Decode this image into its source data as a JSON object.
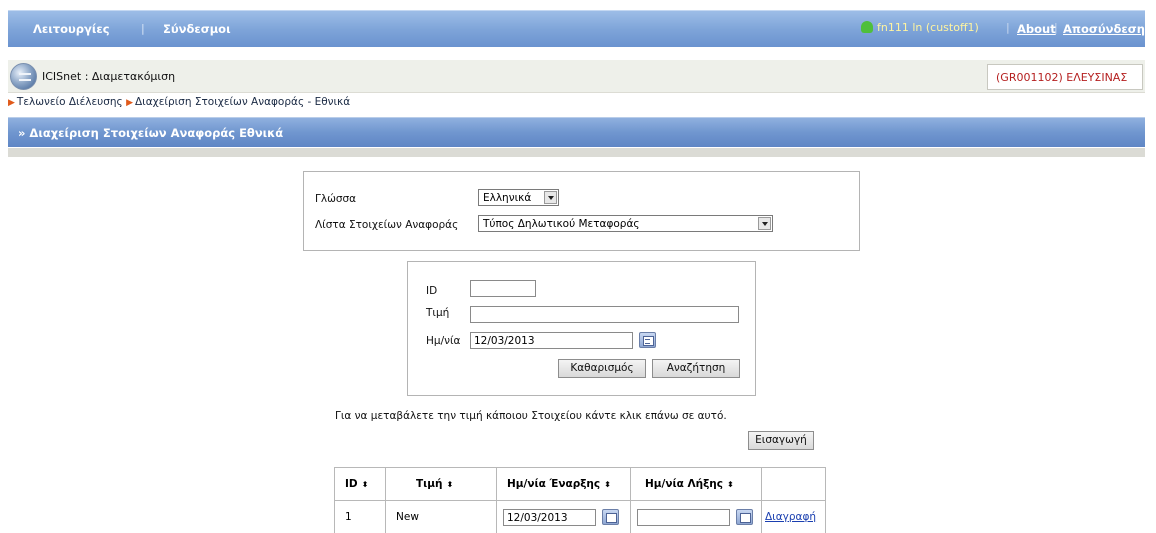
{
  "topbar": {
    "menu_label": "Λειτουργίες",
    "links_label": "Σύνδεσμοι",
    "user_label": "fn111 ln (custoff1)",
    "about_label": "About",
    "logout_label": "Αποσύνδεση",
    "accent": "#7fa5d9"
  },
  "app": {
    "title": "ICISnet : Διαμετακόμιση",
    "office": "(GR001102) ΕΛΕΥΣΙΝΑΣ"
  },
  "breadcrumb": {
    "items": [
      "Τελωνείο Διέλευσης",
      "Διαχείριση Στοιχείων Αναφοράς - Εθνικά"
    ]
  },
  "section": {
    "title": "» Διαχείριση Στοιχείων Αναφοράς Εθνικά"
  },
  "filters": {
    "language_label": "Γλώσσα",
    "language_value": "Ελληνικά",
    "list_label": "Λίστα Στοιχείων Αναφοράς",
    "list_value": "Τύπος Δηλωτικού Μεταφοράς"
  },
  "search": {
    "id_label": "ID",
    "id_value": "",
    "value_label": "Τιμή",
    "value_value": "",
    "date_label": "Ημ/νία",
    "date_value": "12/03/2013",
    "clear_label": "Καθαρισμός",
    "search_label": "Αναζήτηση"
  },
  "hint": "Για να μεταβάλετε την τιμή κάποιου Στοιχείου κάντε κλικ επάνω σε αυτό.",
  "insert_label": "Εισαγωγή",
  "table": {
    "headers": [
      "ID",
      "Τιμή",
      "Ημ/νία Έναρξης",
      "Ημ/νία Λήξης"
    ],
    "sort_glyph": "⬍",
    "rows": [
      {
        "id": "1",
        "value": "New",
        "start": "12/03/2013",
        "end": "",
        "action": "Διαγραφή"
      }
    ]
  }
}
